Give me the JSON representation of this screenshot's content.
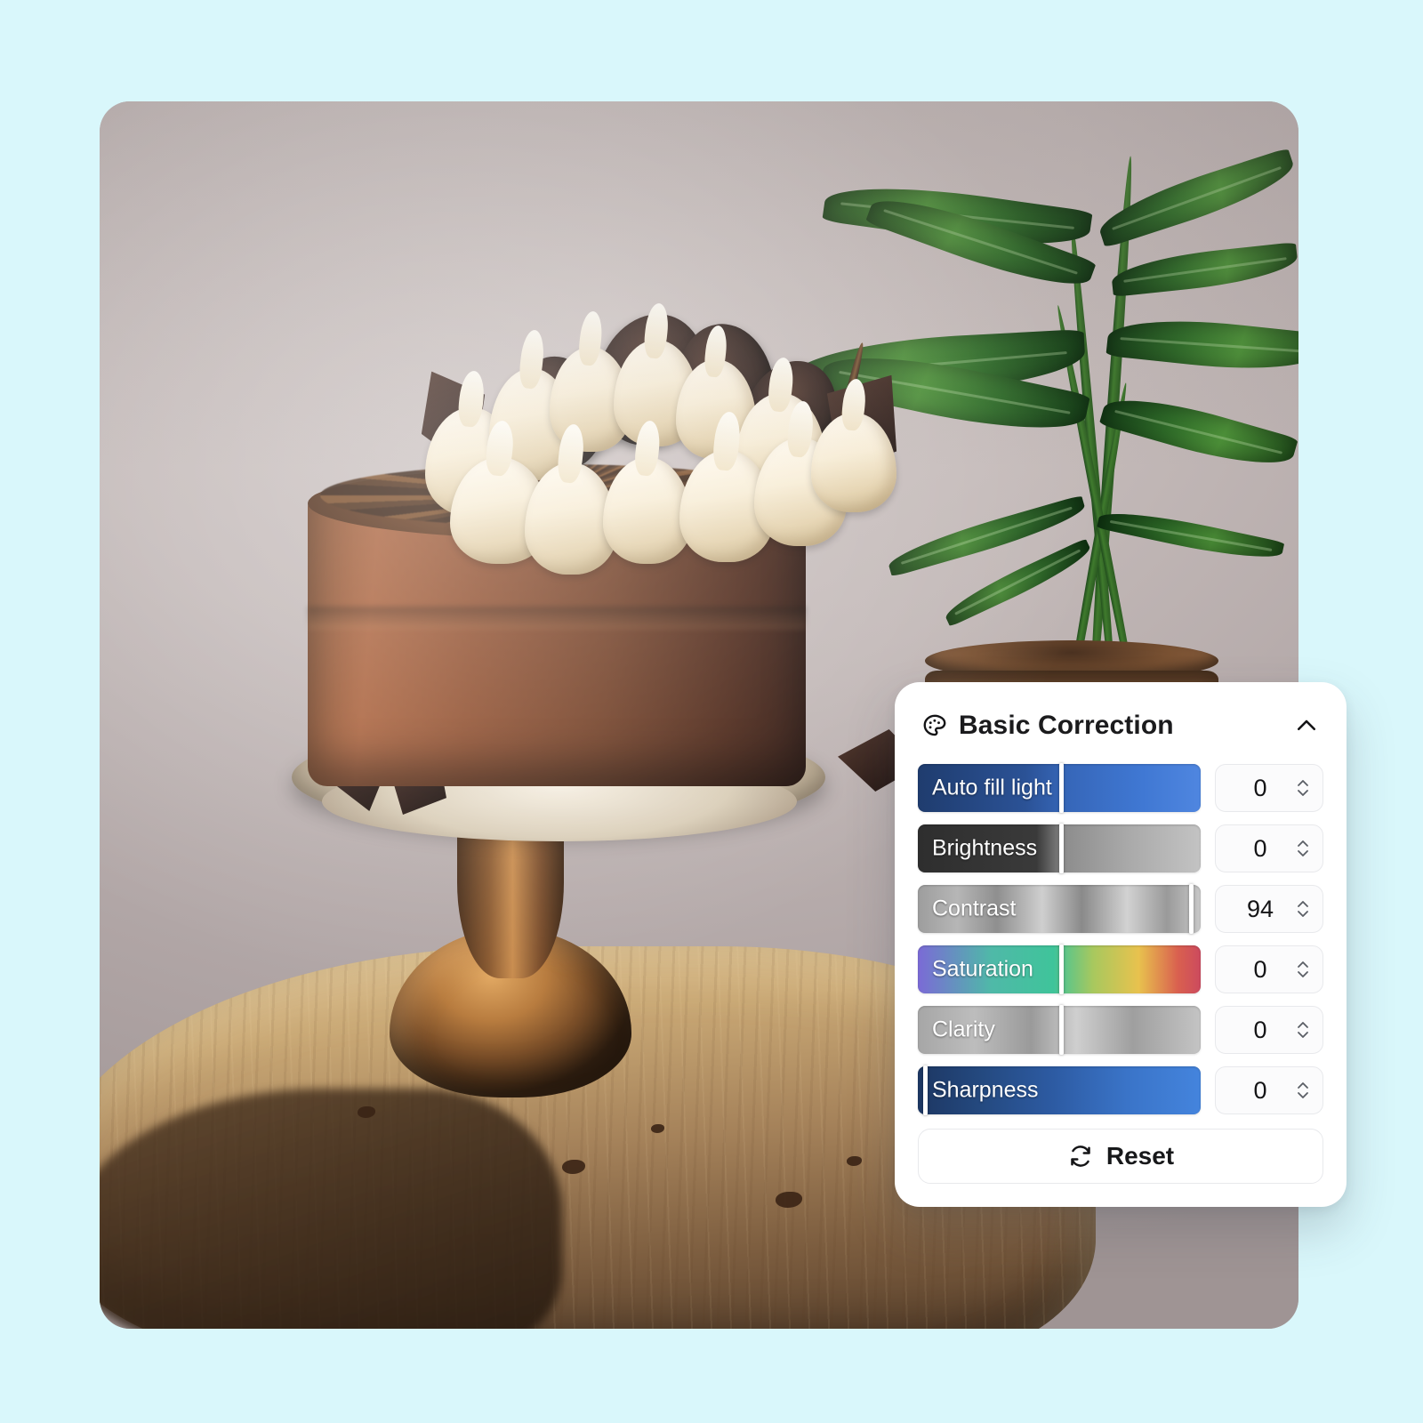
{
  "background": {
    "color": "#d9f7fb"
  },
  "photo": {
    "alt": "Chocolate layer cake topped with cream swirls and chocolate cookies on a wooden cake stand, with a potted palm in the background",
    "subject": "chocolate-cake"
  },
  "panel": {
    "title": "Basic Correction",
    "icon": "palette-icon",
    "collapse_icon": "chevron-up-icon",
    "accent": "#3b6fd4",
    "sliders": [
      {
        "label": "Auto fill light",
        "value": "0",
        "percent": 50,
        "style": "blue"
      },
      {
        "label": "Brightness",
        "value": "0",
        "percent": 50,
        "style": "gray"
      },
      {
        "label": "Contrast",
        "value": "94",
        "percent": 96,
        "style": "contrast"
      },
      {
        "label": "Saturation",
        "value": "0",
        "percent": 50,
        "style": "rainbow"
      },
      {
        "label": "Clarity",
        "value": "0",
        "percent": 50,
        "style": "clarity"
      },
      {
        "label": "Sharpness",
        "value": "0",
        "percent": 2,
        "style": "blue"
      }
    ],
    "reset": {
      "label": "Reset",
      "icon": "refresh-icon"
    },
    "stepper_icons": {
      "up": "chevron-up-icon",
      "down": "chevron-down-icon"
    }
  }
}
